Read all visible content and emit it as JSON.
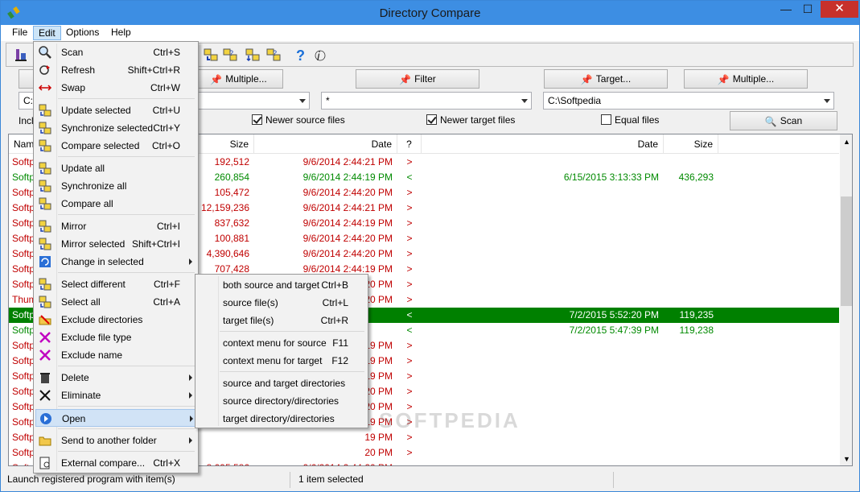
{
  "window": {
    "title": "Directory Compare",
    "minimize": "—",
    "maximize": "☐",
    "close": "✕"
  },
  "menubar": [
    "File",
    "Edit",
    "Options",
    "Help"
  ],
  "buttons": {
    "multiple_left": "Multiple...",
    "filter": "Filter",
    "target": "Target...",
    "multiple_right": "Multiple...",
    "scan": "Scan"
  },
  "combos": {
    "source_path": "C:\\",
    "filter_value": "*",
    "target_path": "C:\\Softpedia"
  },
  "include_label": "Inclu",
  "checkboxes": {
    "newer_source": "Newer source files",
    "newer_target": "Newer target files",
    "equal": "Equal files"
  },
  "list_headers": {
    "name": "Name",
    "size": "Size",
    "date": "Date",
    "status": "?",
    "target_date": "Date",
    "target_size": "Size"
  },
  "rows": [
    {
      "name": "Softp",
      "size": "192,512",
      "date": "9/6/2014 2:44:21 PM",
      "status": ">",
      "tdate": "",
      "tsize": "",
      "color": "red"
    },
    {
      "name": "Softp",
      "size": "260,854",
      "date": "9/6/2014 2:44:19 PM",
      "status": "<",
      "tdate": "6/15/2015 3:13:33 PM",
      "tsize": "436,293",
      "color": "green"
    },
    {
      "name": "Softp",
      "size": "105,472",
      "date": "9/6/2014 2:44:20 PM",
      "status": ">",
      "tdate": "",
      "tsize": "",
      "color": "red"
    },
    {
      "name": "Softp",
      "size": "12,159,236",
      "date": "9/6/2014 2:44:21 PM",
      "status": ">",
      "tdate": "",
      "tsize": "",
      "color": "red"
    },
    {
      "name": "Softp",
      "size": "837,632",
      "date": "9/6/2014 2:44:19 PM",
      "status": ">",
      "tdate": "",
      "tsize": "",
      "color": "red"
    },
    {
      "name": "Softp",
      "size": "100,881",
      "date": "9/6/2014 2:44:20 PM",
      "status": ">",
      "tdate": "",
      "tsize": "",
      "color": "red"
    },
    {
      "name": "Softp",
      "size": "4,390,646",
      "date": "9/6/2014 2:44:20 PM",
      "status": ">",
      "tdate": "",
      "tsize": "",
      "color": "red"
    },
    {
      "name": "Softp",
      "size": "707,428",
      "date": "9/6/2014 2:44:19 PM",
      "status": ">",
      "tdate": "",
      "tsize": "",
      "color": "red"
    },
    {
      "name": "Softp",
      "size": "",
      "date": "20 PM",
      "status": ">",
      "tdate": "",
      "tsize": "",
      "color": "red"
    },
    {
      "name": "Thum",
      "size": "",
      "date": "20 PM",
      "status": ">",
      "tdate": "",
      "tsize": "",
      "color": "red"
    },
    {
      "name": "Softp",
      "size": "",
      "date": "",
      "status": "<",
      "tdate": "7/2/2015 5:52:20 PM",
      "tsize": "119,235",
      "color": "sel"
    },
    {
      "name": "Softp",
      "size": "",
      "date": "",
      "status": "<",
      "tdate": "7/2/2015 5:47:39 PM",
      "tsize": "119,238",
      "color": "green"
    },
    {
      "name": "Softp",
      "size": "",
      "date": "19 PM",
      "status": ">",
      "tdate": "",
      "tsize": "",
      "color": "red"
    },
    {
      "name": "Softp",
      "size": "",
      "date": "19 PM",
      "status": ">",
      "tdate": "",
      "tsize": "",
      "color": "red"
    },
    {
      "name": "Softp",
      "size": "",
      "date": "19 PM",
      "status": ">",
      "tdate": "",
      "tsize": "",
      "color": "red"
    },
    {
      "name": "Softp",
      "size": "",
      "date": "20 PM",
      "status": ">",
      "tdate": "",
      "tsize": "",
      "color": "red"
    },
    {
      "name": "Softp",
      "size": "",
      "date": "20 PM",
      "status": ">",
      "tdate": "",
      "tsize": "",
      "color": "red"
    },
    {
      "name": "Softp",
      "size": "",
      "date": "19 PM",
      "status": ">",
      "tdate": "",
      "tsize": "",
      "color": "red"
    },
    {
      "name": "Softp",
      "size": "",
      "date": "19 PM",
      "status": ">",
      "tdate": "",
      "tsize": "",
      "color": "red"
    },
    {
      "name": "Softp",
      "size": "",
      "date": "20 PM",
      "status": ">",
      "tdate": "",
      "tsize": "",
      "color": "red"
    },
    {
      "name": "Softp",
      "size": "8,095,586",
      "date": "9/6/2014 2:44:20 PM",
      "status": ">",
      "tdate": "",
      "tsize": "",
      "color": "red"
    },
    {
      "name": "Softp",
      "size": "6,700",
      "date": "9/18/2014 11:15:3...",
      "status": ">",
      "tdate": "",
      "tsize": "",
      "color": "red"
    },
    {
      "name": "Softp",
      "size": "0",
      "date": "9/6/2014 2:44:20 PM",
      "status": ">",
      "tdate": "",
      "tsize": "",
      "color": "red"
    }
  ],
  "edit_menu": [
    {
      "label": "Scan",
      "shortcut": "Ctrl+S",
      "icon": "magnifier-icon"
    },
    {
      "label": "Refresh",
      "shortcut": "Shift+Ctrl+R",
      "icon": "refresh-icon"
    },
    {
      "label": "Swap",
      "shortcut": "Ctrl+W",
      "icon": "swap-arrows-icon"
    },
    {
      "label": "Update selected",
      "shortcut": "Ctrl+U",
      "icon": "update-selected-icon"
    },
    {
      "label": "Synchronize selected",
      "shortcut": "Ctrl+Y",
      "icon": "sync-selected-icon"
    },
    {
      "label": "Compare selected",
      "shortcut": "Ctrl+O",
      "icon": "compare-selected-icon"
    },
    {
      "label": "Update all",
      "shortcut": "",
      "icon": "update-all-icon"
    },
    {
      "label": "Synchronize all",
      "shortcut": "",
      "icon": "sync-all-icon"
    },
    {
      "label": "Compare all",
      "shortcut": "",
      "icon": "compare-all-icon"
    },
    {
      "label": "Mirror",
      "shortcut": "Ctrl+I",
      "icon": "mirror-icon"
    },
    {
      "label": "Mirror selected",
      "shortcut": "Shift+Ctrl+I",
      "icon": "mirror-selected-icon"
    },
    {
      "label": "Change in selected",
      "shortcut": "",
      "icon": "change-icon"
    },
    {
      "label": "Select different",
      "shortcut": "Ctrl+F",
      "icon": "select-different-icon"
    },
    {
      "label": "Select all",
      "shortcut": "Ctrl+A",
      "icon": "select-all-icon"
    },
    {
      "label": "Exclude directories",
      "shortcut": "",
      "icon": "exclude-dir-icon"
    },
    {
      "label": "Exclude file type",
      "shortcut": "",
      "icon": "exclude-type-icon"
    },
    {
      "label": "Exclude name",
      "shortcut": "",
      "icon": "exclude-name-icon"
    },
    {
      "label": "Delete",
      "shortcut": "",
      "icon": "trash-icon"
    },
    {
      "label": "Eliminate",
      "shortcut": "",
      "icon": "x-icon"
    },
    {
      "label": "Open",
      "shortcut": "",
      "icon": "open-icon"
    },
    {
      "label": "Send to another folder",
      "shortcut": "",
      "icon": "folder-icon"
    },
    {
      "label": "External compare...",
      "shortcut": "Ctrl+X",
      "icon": "external-compare-icon"
    }
  ],
  "open_submenu": [
    {
      "label": "both source and target",
      "shortcut": "Ctrl+B"
    },
    {
      "label": "source file(s)",
      "shortcut": "Ctrl+L"
    },
    {
      "label": "target file(s)",
      "shortcut": "Ctrl+R"
    },
    {
      "label": "context menu for source",
      "shortcut": "F11"
    },
    {
      "label": "context menu for target",
      "shortcut": "F12"
    },
    {
      "label": "source and target directories",
      "shortcut": ""
    },
    {
      "label": "source directory/directories",
      "shortcut": ""
    },
    {
      "label": "target  directory/directories",
      "shortcut": ""
    }
  ],
  "status": {
    "left": "Launch registered program with item(s)",
    "right": "1 item selected"
  },
  "watermark": "SOFTPEDIA",
  "colors": {
    "title_bar": "#3d8ee3",
    "close": "#c7312b",
    "diff_red": "#c00000",
    "diff_green": "#008a00",
    "selected_row": "#008000"
  }
}
